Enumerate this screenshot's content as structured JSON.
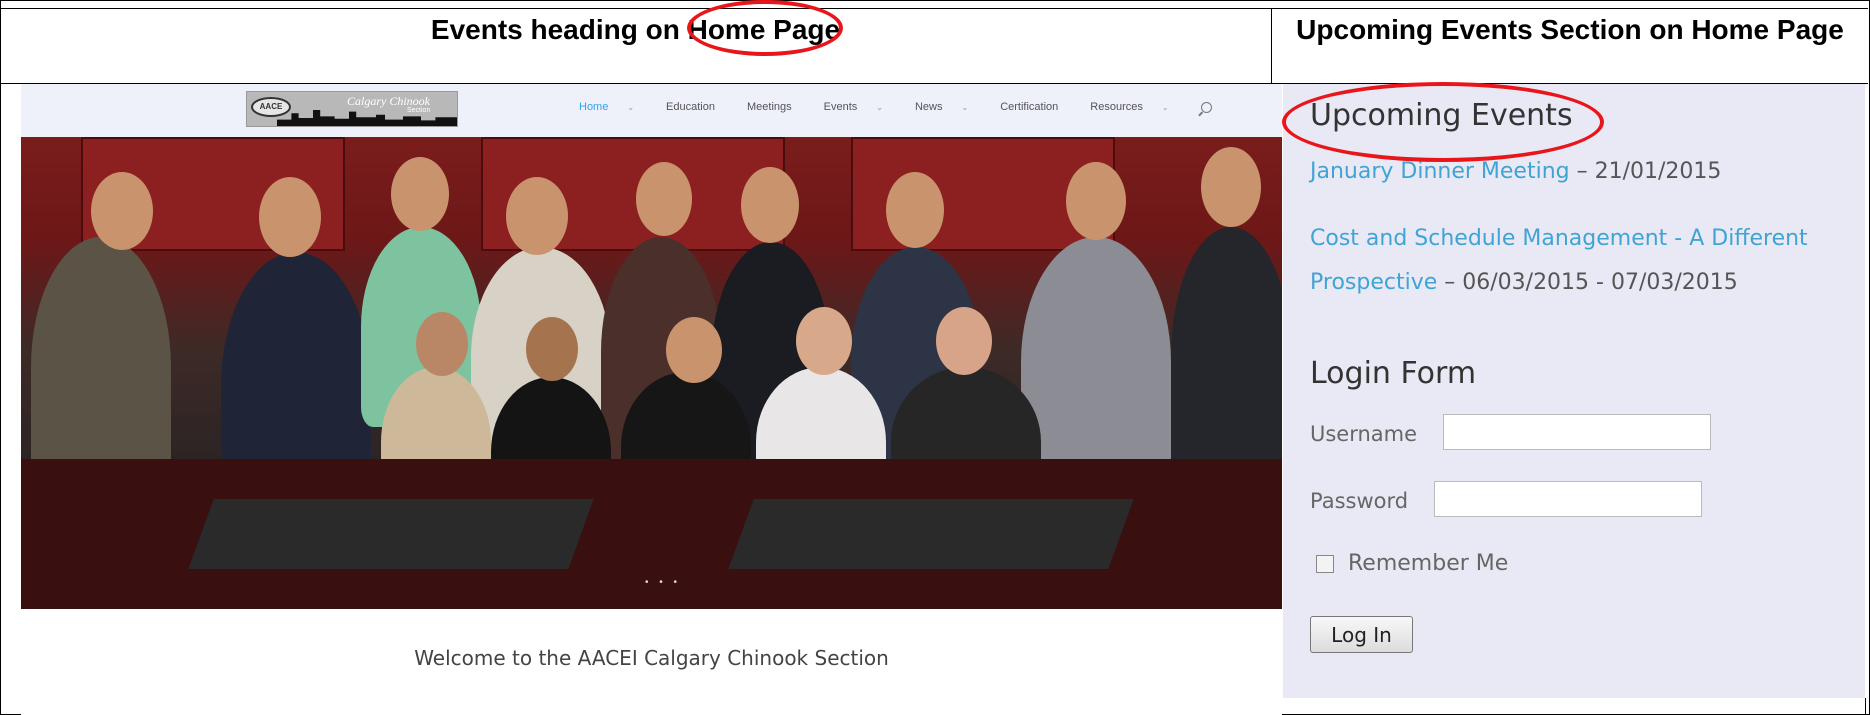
{
  "headers": {
    "left": "Events heading on Home Page",
    "right": "Upcoming Events Section on Home Page"
  },
  "site": {
    "logo": {
      "badge": "AACE",
      "name": "Calgary Chinook",
      "sub": "Section"
    },
    "nav": [
      {
        "label": "Home",
        "active": true,
        "dropdown": true
      },
      {
        "label": "Education",
        "active": false,
        "dropdown": false
      },
      {
        "label": "Meetings",
        "active": false,
        "dropdown": false
      },
      {
        "label": "Events",
        "active": false,
        "dropdown": true
      },
      {
        "label": "News",
        "active": false,
        "dropdown": true
      },
      {
        "label": "Certification",
        "active": false,
        "dropdown": false
      },
      {
        "label": "Resources",
        "active": false,
        "dropdown": true
      }
    ],
    "slider_dots": "• • •",
    "welcome": "Welcome to the AACEI Calgary Chinook Section"
  },
  "sidebar": {
    "upcoming_title": "Upcoming Events",
    "events": [
      {
        "link": "January Dinner Meeting",
        "date": " – 21/01/2015"
      },
      {
        "link_line1": "Cost and Schedule Management - A Different",
        "link_line2": "Prospective",
        "date": " – 06/03/2015 - 07/03/2015"
      }
    ],
    "login_title": "Login Form",
    "username_label": "Username",
    "password_label": "Password",
    "remember_label": "Remember Me",
    "login_button": "Log In"
  },
  "colors": {
    "accent": "#2ea3f2",
    "link": "#3fa4d3",
    "highlight": "#e8161b",
    "sidebar_bg": "#e9e9f5"
  }
}
